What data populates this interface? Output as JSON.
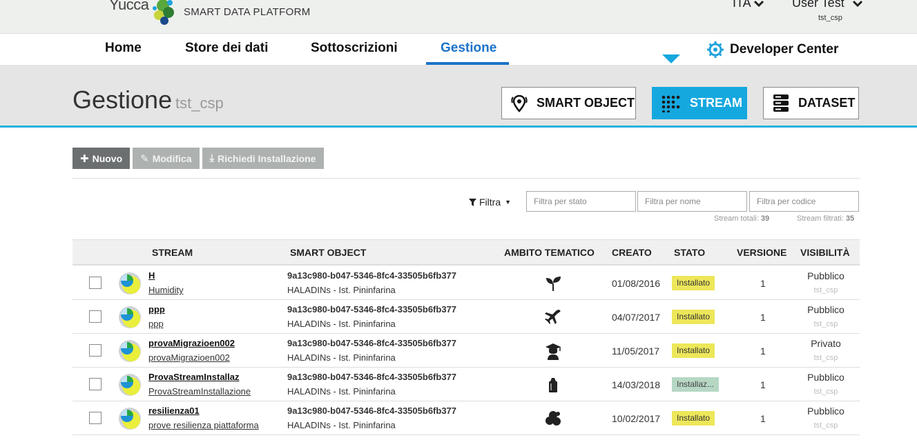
{
  "header": {
    "logo_text": "Yucca",
    "platform": "SMART DATA PLATFORM",
    "language": "ITA",
    "user_name": "User Test",
    "user_tenant": "tst_csp"
  },
  "nav": {
    "items": [
      {
        "label": "Home"
      },
      {
        "label": "Store dei dati"
      },
      {
        "label": "Sottoscrizioni"
      },
      {
        "label": "Gestione"
      }
    ],
    "active": "Gestione",
    "developer_center": "Developer Center"
  },
  "band": {
    "title": "Gestione",
    "subtitle": "tst_csp",
    "buttons": [
      {
        "label": "SMART OBJECT",
        "icon": "location-pin-icon"
      },
      {
        "label": "STREAM",
        "icon": "dots-grid-icon"
      },
      {
        "label": "DATASET",
        "icon": "server-stack-icon"
      }
    ],
    "active_button": "STREAM"
  },
  "actions": {
    "new_label": "Nuovo",
    "edit_label": "Modifica",
    "install_label": "Richiedi Installazione"
  },
  "filters": {
    "filter_label": "Filtra",
    "state_placeholder": "Filtra per stato",
    "name_placeholder": "Filtra per nome",
    "code_placeholder": "Filtra per codice",
    "total_label": "Stream totali:",
    "total_value": "39",
    "filtered_label": "Stream filtrati:",
    "filtered_value": "35"
  },
  "table": {
    "columns": [
      "STREAM",
      "SMART OBJECT",
      "AMBITO TEMATICO",
      "CREATO",
      "STATO",
      "VERSIONE",
      "VISIBILITÀ"
    ],
    "rows": [
      {
        "code": "H",
        "name": "Humidity",
        "so_id": "9a13c980-b047-5346-8fc4-33505b6fb377",
        "so_name": "HALADINs - Ist. Pininfarina",
        "ambito_icon": "plant-icon",
        "created": "01/08/2016",
        "status": "Installato",
        "version": "1",
        "visibility": "Pubblico",
        "tenant": "tst_csp"
      },
      {
        "code": "ppp",
        "name": "ppp",
        "so_id": "9a13c980-b047-5346-8fc4-33505b6fb377",
        "so_name": "HALADINs - Ist. Pininfarina",
        "ambito_icon": "airplane-icon",
        "created": "04/07/2017",
        "status": "Installato",
        "version": "1",
        "visibility": "Pubblico",
        "tenant": "tst_csp"
      },
      {
        "code": "provaMigrazioen002",
        "name": "provaMigrazioen002",
        "so_id": "9a13c980-b047-5346-8fc4-33505b6fb377",
        "so_name": "HALADINs - Ist. Pininfarina",
        "ambito_icon": "graduate-icon",
        "created": "11/05/2017",
        "status": "Installato",
        "version": "1",
        "visibility": "Privato",
        "tenant": "tst_csp"
      },
      {
        "code": "ProvaStreamInstallaz",
        "name": "ProvaStreamInstallazione",
        "so_id": "9a13c980-b047-5346-8fc4-33505b6fb377",
        "so_name": "HALADINs - Ist. Pininfarina",
        "ambito_icon": "trash-bin-icon",
        "created": "14/03/2018",
        "status": "Installaz...",
        "version": "1",
        "visibility": "Pubblico",
        "tenant": "tst_csp"
      },
      {
        "code": "resilienza01",
        "name": "prove resilienza piattaforma",
        "so_id": "9a13c980-b047-5346-8fc4-33505b6fb377",
        "so_name": "HALADINs - Ist. Pininfarina",
        "ambito_icon": "people-group-icon",
        "created": "10/02/2017",
        "status": "Installato",
        "version": "1",
        "visibility": "Pubblico",
        "tenant": "tst_csp"
      }
    ]
  },
  "colors": {
    "accent_blue": "#1a73c8",
    "stream_blue": "#15a8df",
    "status_installed": "#ede75a",
    "status_installing": "#b6d7c4"
  }
}
